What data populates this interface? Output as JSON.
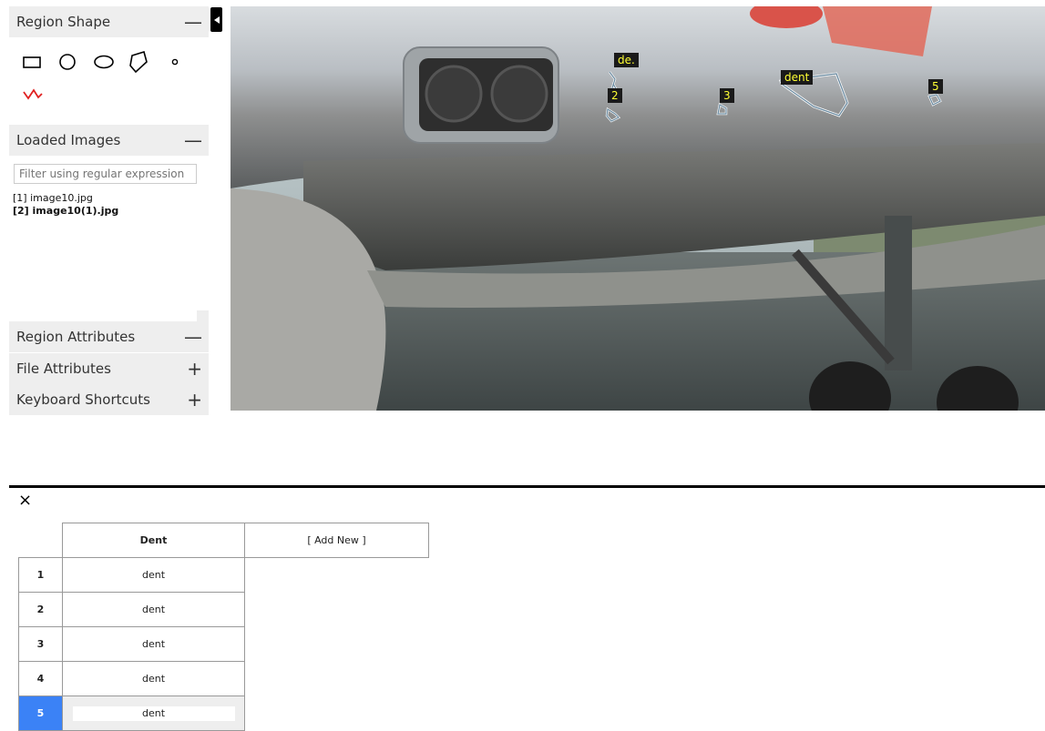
{
  "panels": {
    "region_shape": {
      "title": "Region Shape",
      "toggle": "—"
    },
    "loaded_images": {
      "title": "Loaded Images",
      "toggle": "—",
      "filter_placeholder": "Filter using regular expression",
      "images": [
        {
          "label": "[1] image10.jpg",
          "active": false
        },
        {
          "label": "[2] image10(1).jpg",
          "active": true
        }
      ]
    },
    "region_attributes": {
      "title": "Region Attributes",
      "toggle": "—"
    },
    "file_attributes": {
      "title": "File Attributes",
      "toggle": "+"
    },
    "keyboard_shortcuts": {
      "title": "Keyboard Shortcuts",
      "toggle": "+"
    }
  },
  "shape_tools": [
    "rectangle-icon",
    "circle-icon",
    "ellipse-icon",
    "polygon-icon",
    "point-icon",
    "polyline-icon"
  ],
  "regions": [
    {
      "label": "de."
    },
    {
      "label": "2"
    },
    {
      "label": "3"
    },
    {
      "label": "dent"
    },
    {
      "label": "5"
    }
  ],
  "editor": {
    "close": "×",
    "columns": {
      "dent": "Dent",
      "add_new": "[ Add New ]"
    },
    "rows": [
      {
        "index": "1",
        "dent": "dent"
      },
      {
        "index": "2",
        "dent": "dent"
      },
      {
        "index": "3",
        "dent": "dent"
      },
      {
        "index": "4",
        "dent": "dent"
      },
      {
        "index": "5",
        "dent": "dent"
      }
    ],
    "selected_row": "5"
  },
  "colors": {
    "accent": "#3b82f6",
    "region_label_text": "#ffff33",
    "region_label_bg": "#1a1a1a",
    "polyline_tool": "#e02020",
    "header_bg": "#eeeeee"
  }
}
